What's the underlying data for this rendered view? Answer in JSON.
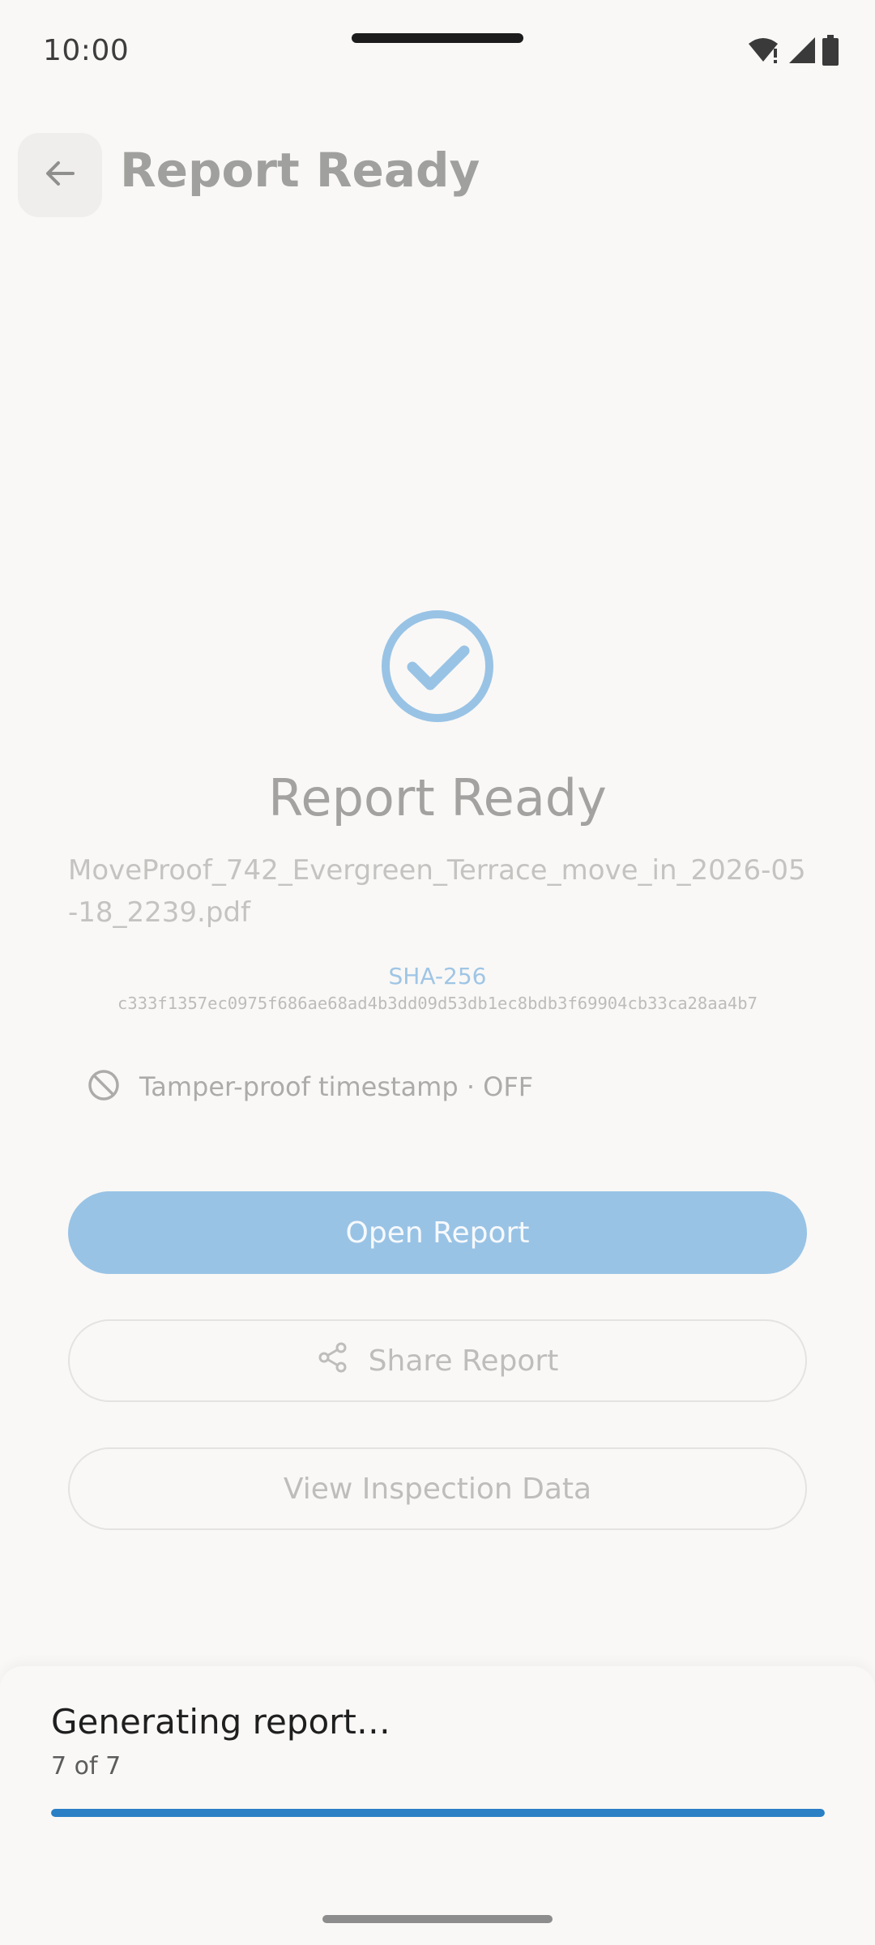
{
  "status_bar": {
    "time": "10:00",
    "icons": [
      "wifi-alert-icon",
      "signal-icon",
      "battery-icon"
    ]
  },
  "app_bar": {
    "back_icon": "arrow-left-icon",
    "title": "Report Ready"
  },
  "result": {
    "icon": "check-circle-icon",
    "heading": "Report Ready",
    "filename": "MoveProof_742_Evergreen_Terrace_move_in_2026-05-18_2239.pdf",
    "hash_label": "SHA-256",
    "hash_value": "c333f1357ec0975f686ae68ad4b3dd09d53db1ec8bdb3f69904cb33ca28aa4b7",
    "tamper_icon": "block-icon",
    "tamper_text": "Tamper-proof timestamp · OFF"
  },
  "actions": {
    "open_label": "Open Report",
    "share_label": "Share Report",
    "share_icon": "share-icon",
    "view_label": "View Inspection Data"
  },
  "progress_sheet": {
    "title": "Generating report…",
    "step_text": "7 of 7",
    "progress_fraction": 1.0
  },
  "colors": {
    "accent": "#2a7fc5",
    "primary_button": "#99c3e5",
    "check_icon": "#99c3e5"
  }
}
